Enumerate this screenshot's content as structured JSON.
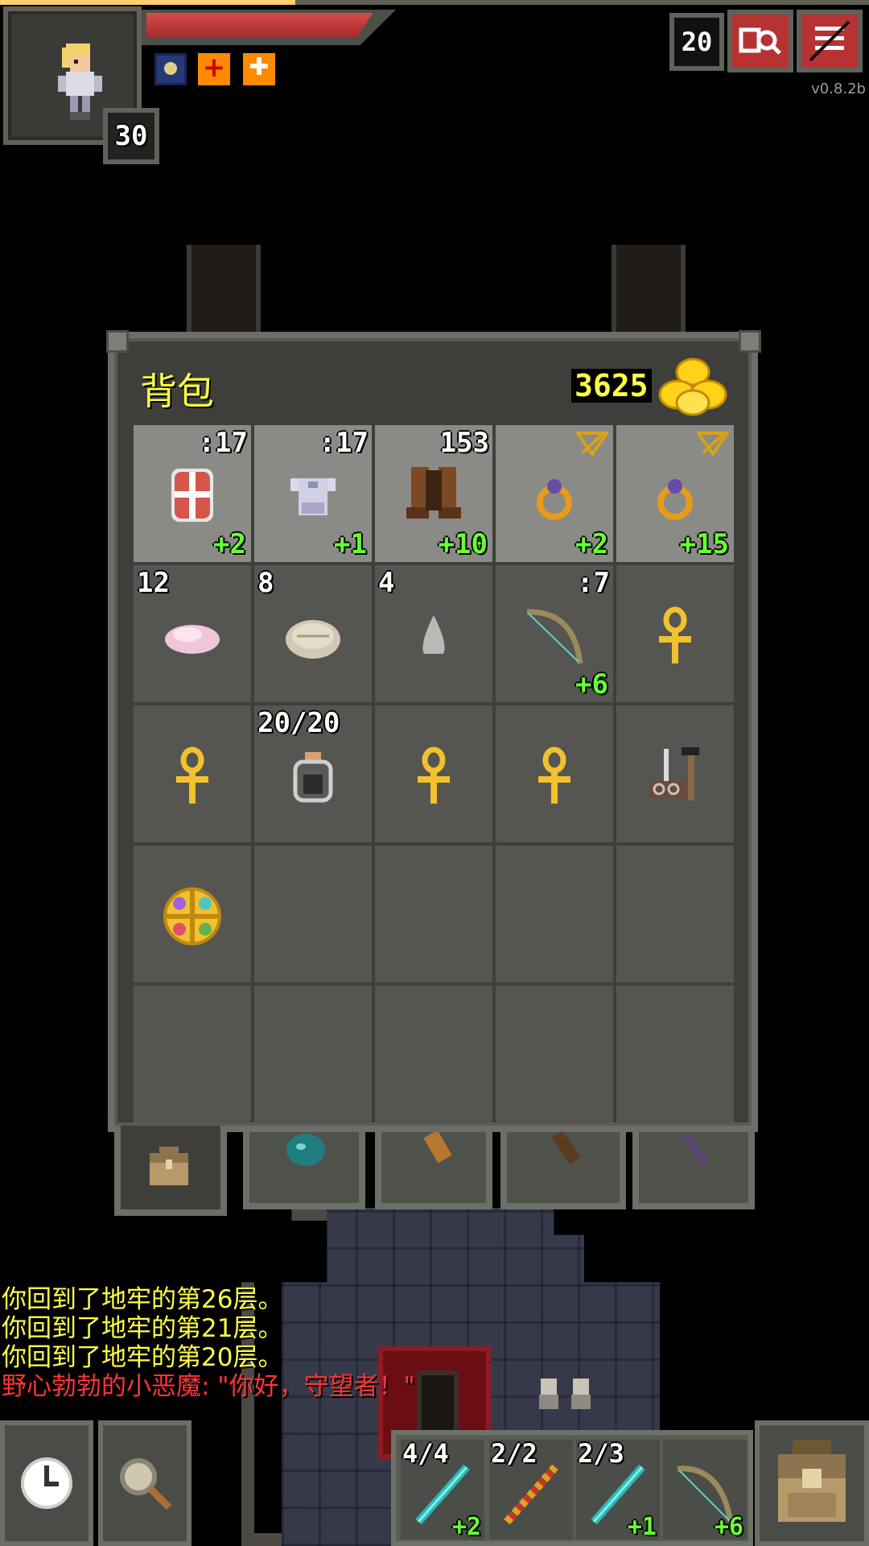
{
  "status": {
    "hero_level": "30",
    "depth": "20",
    "version": "v0.8.2b",
    "hp_percent": 0.89,
    "exp_percent": 0.34,
    "buff_icons": [
      "mind-vision-buff-icon",
      "bless-buff-icon",
      "shield-buff-icon"
    ]
  },
  "inventory": {
    "title": "背包",
    "gold": "3625",
    "rows": [
      [
        {
          "item": "armor-shield-icon",
          "tl": "",
          "tr": ":17",
          "br": "+2",
          "equipped": true
        },
        {
          "item": "plate-armor-icon",
          "tl": "",
          "tr": ":17",
          "br": "+1",
          "equipped": true
        },
        {
          "item": "boots-icon",
          "tl": "",
          "tr": "153",
          "br": "+10",
          "equipped": true
        },
        {
          "item": "ring-icon",
          "tl": "",
          "tr": "",
          "br": "+2",
          "equipped": true,
          "tr_icon": "sword-badge-icon"
        },
        {
          "item": "ring-icon",
          "tl": "",
          "tr": "",
          "br": "+15",
          "equipped": true,
          "tr_icon": "sword-badge-icon"
        }
      ],
      [
        {
          "item": "pink-stone-icon",
          "tl": "12",
          "tr": "",
          "br": ""
        },
        {
          "item": "bread-icon",
          "tl": "8",
          "tr": "",
          "br": ""
        },
        {
          "item": "seed-drop-icon",
          "tl": "4",
          "tr": "",
          "br": ""
        },
        {
          "item": "bow-icon",
          "tl": "",
          "tr": ":7",
          "br": "+6"
        },
        {
          "item": "ankh-icon",
          "tl": "",
          "tr": "",
          "br": ""
        }
      ],
      [
        {
          "item": "ankh-icon",
          "tl": "",
          "tr": "",
          "br": ""
        },
        {
          "item": "dew-vial-icon",
          "tl": "20/20",
          "tr": "",
          "br": ""
        },
        {
          "item": "ankh-icon",
          "tl": "",
          "tr": "",
          "br": ""
        },
        {
          "item": "ankh-icon",
          "tl": "",
          "tr": "",
          "br": ""
        },
        {
          "item": "smithing-tools-icon",
          "tl": "",
          "tr": "",
          "br": ""
        }
      ],
      [
        {
          "item": "gem-amulet-icon",
          "tl": "",
          "tr": "",
          "br": ""
        },
        {
          "item": "",
          "tl": "",
          "tr": "",
          "br": ""
        },
        {
          "item": "",
          "tl": "",
          "tr": "",
          "br": ""
        },
        {
          "item": "",
          "tl": "",
          "tr": "",
          "br": ""
        },
        {
          "item": "",
          "tl": "",
          "tr": "",
          "br": ""
        }
      ],
      [
        {
          "item": "",
          "tl": "",
          "tr": "",
          "br": ""
        },
        {
          "item": "",
          "tl": "",
          "tr": "",
          "br": ""
        },
        {
          "item": "",
          "tl": "",
          "tr": "",
          "br": ""
        },
        {
          "item": "",
          "tl": "",
          "tr": "",
          "br": ""
        },
        {
          "item": "",
          "tl": "",
          "tr": "",
          "br": ""
        }
      ]
    ],
    "tabs": [
      "backpack-icon",
      "seed-pouch-icon",
      "scroll-holder-icon",
      "wand-holster-icon",
      "magic-wand-icon"
    ]
  },
  "log": [
    {
      "text": "你回到了地牢的第26层。",
      "color": "#ffff44"
    },
    {
      "text": "你回到了地牢的第21层。",
      "color": "#ffff44"
    },
    {
      "text": "你回到了地牢的第20层。",
      "color": "#ffff44"
    },
    {
      "text": "野心勃勃的小恶魔: \"你好，守望者！\"",
      "color": "#ff3434"
    }
  ],
  "quickslots": [
    {
      "item": "teal-wand-icon",
      "charge": "4/4",
      "bonus": "+2"
    },
    {
      "item": "fire-wand-icon",
      "charge": "2/2",
      "bonus": ""
    },
    {
      "item": "teal-wand-icon",
      "charge": "2/3",
      "bonus": "+1"
    },
    {
      "item": "bow-icon",
      "charge": "",
      "bonus": "+6"
    }
  ],
  "toolbar": {
    "wait_icon": "clock-icon",
    "search_icon": "magnifier-icon",
    "backpack_icon": "backpack-icon"
  }
}
